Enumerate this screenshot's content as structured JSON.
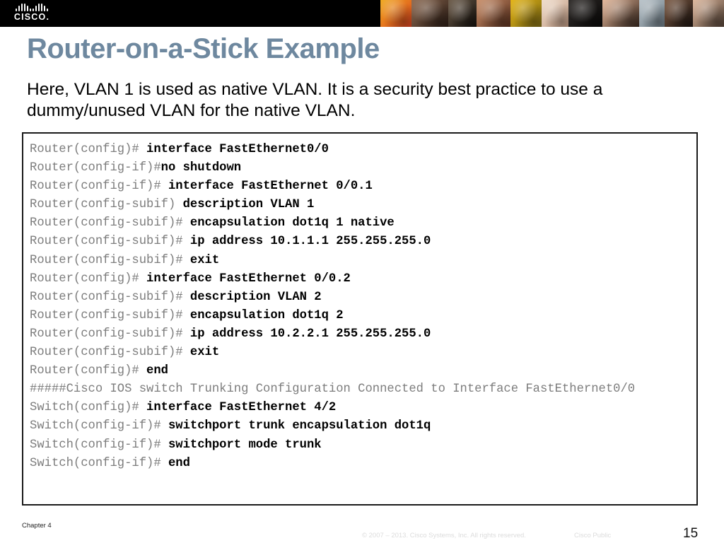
{
  "header": {
    "logo_name": "cisco-logo",
    "logo_wordmark": "CISCO.",
    "background_color": "#000000",
    "photo_strip": [
      {
        "name": "photo-abstract-orange",
        "c1": "#f0a81c",
        "c2": "#d9411f"
      },
      {
        "name": "photo-woman-dark-hair",
        "c1": "#8c6a52",
        "c2": "#2d1d15"
      },
      {
        "name": "photo-man-suit-thinking",
        "c1": "#6b5a48",
        "c2": "#14100c"
      },
      {
        "name": "photo-smiling-woman",
        "c1": "#c98f6a",
        "c2": "#5a2f1c"
      },
      {
        "name": "photo-yellow-pattern",
        "c1": "#e3b312",
        "c2": "#7d6a14"
      },
      {
        "name": "photo-person-pale",
        "c1": "#efdccb",
        "c2": "#c09a82"
      },
      {
        "name": "photo-dark-scene",
        "c1": "#2e2a28",
        "c2": "#0a0908"
      },
      {
        "name": "photo-asian-woman",
        "c1": "#e3b79a",
        "c2": "#3c2a20"
      },
      {
        "name": "photo-blue-grey-blur",
        "c1": "#b9c3c9",
        "c2": "#6c7a84"
      },
      {
        "name": "photo-man-white-shirt",
        "c1": "#7c5a44",
        "c2": "#1d1410"
      },
      {
        "name": "photo-young-man-cap",
        "c1": "#ddb79c",
        "c2": "#544236"
      }
    ]
  },
  "title": {
    "text": "Router-on-a-Stick Example",
    "color": "#6e889f"
  },
  "body": {
    "text": "Here, VLAN 1 is used as native VLAN. It is a security best practice to use a dummy/unused VLAN for the native VLAN."
  },
  "code_block": {
    "lines": [
      {
        "prompt": "Router(config)# ",
        "cmd": "interface FastEthernet0/0"
      },
      {
        "prompt": "Router(config-if)#",
        "cmd": "no shutdown"
      },
      {
        "prompt": "Router(config-if)# ",
        "cmd": "interface FastEthernet 0/0.1"
      },
      {
        "prompt": "Router(config-subif) ",
        "cmd": "description VLAN 1"
      },
      {
        "prompt": "Router(config-subif)# ",
        "cmd": "encapsulation dot1q 1 native"
      },
      {
        "prompt": "Router(config-subif)# ",
        "cmd": "ip address 10.1.1.1 255.255.255.0"
      },
      {
        "prompt": "Router(config-subif)# ",
        "cmd": "exit"
      },
      {
        "prompt": "Router(config)# ",
        "cmd": "interface FastEthernet 0/0.2"
      },
      {
        "prompt": "Router(config-subif)# ",
        "cmd": "description VLAN 2"
      },
      {
        "prompt": "Router(config-subif)# ",
        "cmd": "encapsulation dot1q 2"
      },
      {
        "prompt": "Router(config-subif)# ",
        "cmd": "ip address 10.2.2.1 255.255.255.0"
      },
      {
        "prompt": "Router(config-subif)# ",
        "cmd": "exit"
      },
      {
        "prompt": "Router(config)# ",
        "cmd": "end"
      },
      {
        "prompt": "#####Cisco IOS switch Trunking Configuration Connected to Interface FastEthernet0/0",
        "cmd": ""
      },
      {
        "prompt": "Switch(config)# ",
        "cmd": "interface FastEthernet 4/2"
      },
      {
        "prompt": "Switch(config-if)# ",
        "cmd": "switchport trunk encapsulation dot1q"
      },
      {
        "prompt": "Switch(config-if)# ",
        "cmd": "switchport mode trunk"
      },
      {
        "prompt": "Switch(config-if)# ",
        "cmd": "end"
      }
    ]
  },
  "footer": {
    "chapter": "Chapter 4",
    "copyright": "© 2007 – 2013. Cisco Systems, Inc. All rights reserved.",
    "public": "Cisco Public",
    "page_number": "15"
  }
}
